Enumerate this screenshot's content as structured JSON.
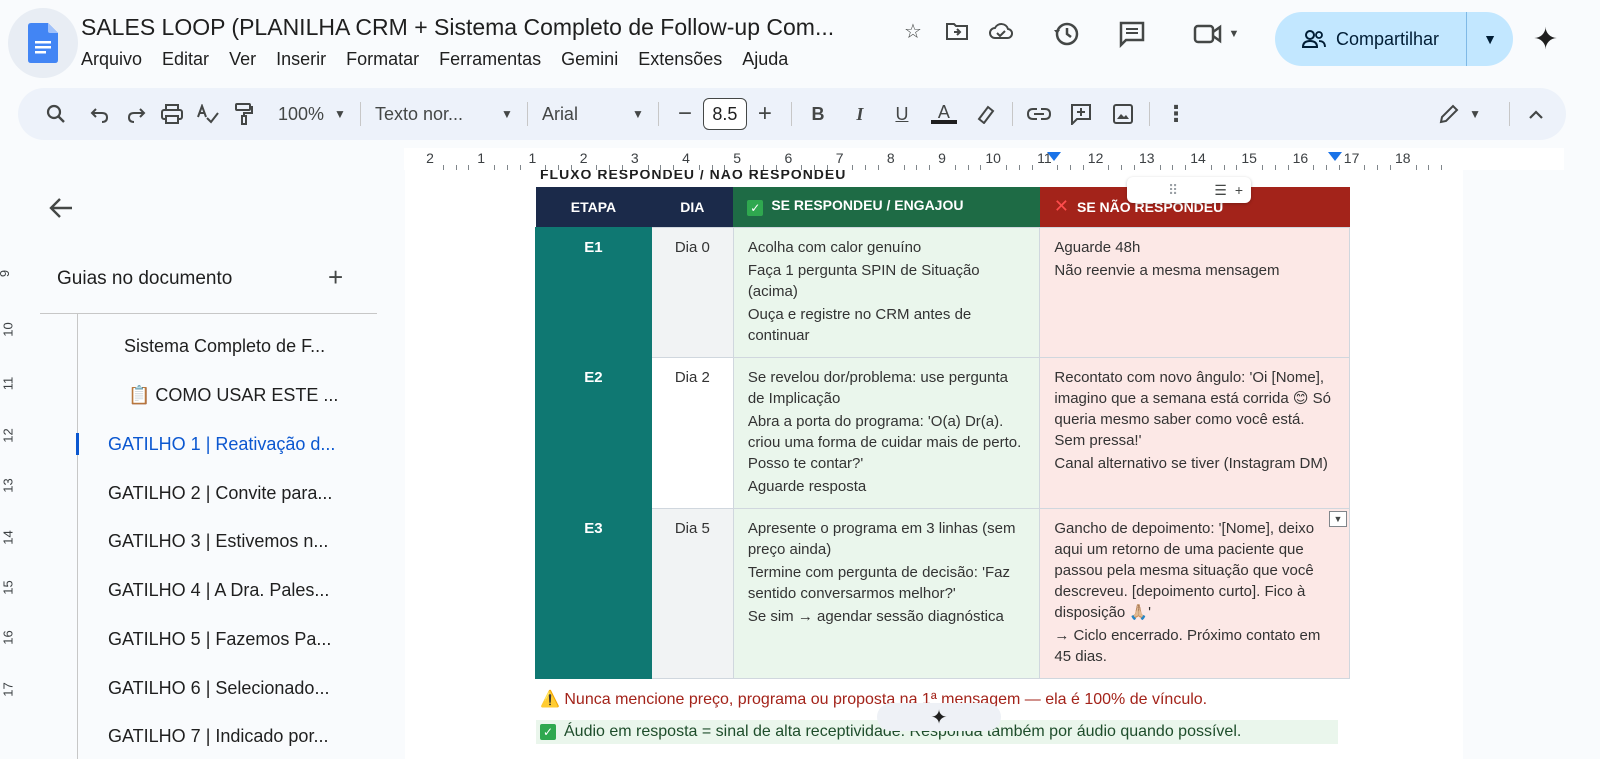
{
  "app": {
    "doc_title": "SALES LOOP (PLANILHA CRM + Sistema Completo de Follow-up Com...",
    "menu": [
      "Arquivo",
      "Editar",
      "Ver",
      "Inserir",
      "Formatar",
      "Ferramentas",
      "Gemini",
      "Extensões",
      "Ajuda"
    ],
    "share_label": "Compartilhar"
  },
  "toolbar": {
    "zoom": "100%",
    "style": "Texto nor...",
    "font": "Arial",
    "font_size": "8.5"
  },
  "ruler": {
    "labels": [
      "2",
      "1",
      "1",
      "2",
      "3",
      "4",
      "5",
      "6",
      "7",
      "8",
      "9",
      "10",
      "11",
      "12",
      "13",
      "14",
      "15",
      "16",
      "17",
      "18"
    ]
  },
  "sidebar": {
    "title": "Guias no documento",
    "items": [
      {
        "label": "Sistema Completo de F...",
        "active": false
      },
      {
        "label": "📋 COMO USAR ESTE ...",
        "active": false
      },
      {
        "label": "GATILHO 1 | Reativação d...",
        "active": true
      },
      {
        "label": "GATILHO 2 | Convite para...",
        "active": false
      },
      {
        "label": "GATILHO 3 | Estivemos n...",
        "active": false
      },
      {
        "label": "GATILHO 4 | A Dra. Pales...",
        "active": false
      },
      {
        "label": "GATILHO 5 | Fazemos Pa...",
        "active": false
      },
      {
        "label": "GATILHO 6 | Selecionado...",
        "active": false
      },
      {
        "label": "GATILHO 7 | Indicado por...",
        "active": false
      }
    ]
  },
  "document": {
    "heading_peek": "FLUXO RESPONDEU / NÃO RESPONDEU",
    "table": {
      "headers": {
        "etapa": "ETAPA",
        "dia": "DIA",
        "yes": "SE RESPONDEU / ENGAJOU",
        "no": "SE NÃO RESPONDEU"
      },
      "rows": [
        {
          "etapa": "E1",
          "dia": "Dia 0",
          "yes": [
            "Acolha com calor genuíno",
            "Faça 1 pergunta SPIN de Situação (acima)",
            "Ouça e registre no CRM antes de continuar"
          ],
          "no": [
            "Aguarde 48h",
            "Não reenvie a mesma mensagem"
          ]
        },
        {
          "etapa": "E2",
          "dia": "Dia 2",
          "yes": [
            "Se revelou dor/problema: use pergunta de Implicação",
            "Abra a porta do programa: 'O(a) Dr(a). criou uma forma de cuidar mais de perto. Posso te contar?'",
            "Aguarde resposta"
          ],
          "no": [
            "Recontato com novo ângulo: 'Oi [Nome], imagino que a semana está corrida 😊 Só queria mesmo saber como você está. Sem pressa!'",
            "Canal alternativo se tiver (Instagram DM)"
          ]
        },
        {
          "etapa": "E3",
          "dia": "Dia 5",
          "yes": [
            "Apresente o programa em 3 linhas (sem preço ainda)",
            "Termine com pergunta de decisão: 'Faz sentido conversarmos melhor?'",
            "Se sim → agendar sessão diagnóstica"
          ],
          "no": [
            "Gancho de depoimento: '[Nome], deixo aqui um retorno de uma paciente que passou pela mesma situação que você descreveu. [depoimento curto]. Fico à disposição 🙏🏼'",
            "→ Ciclo encerrado. Próximo contato em 45 dias."
          ]
        }
      ]
    },
    "warning": "⚠️  Nunca mencione preço, programa ou proposta na 1ª mensagem — ela é 100% de vínculo.",
    "tip": "Áudio em resposta = sinal de alta receptividade. Responda também por áudio quando possível."
  },
  "colors": {
    "header_dark": "#1b2a4a",
    "header_green": "#1e6b45",
    "header_red": "#a3231a",
    "etapa_teal": "#0f7872",
    "share_bg": "#c2e7ff",
    "active_blue": "#0b57d0"
  }
}
